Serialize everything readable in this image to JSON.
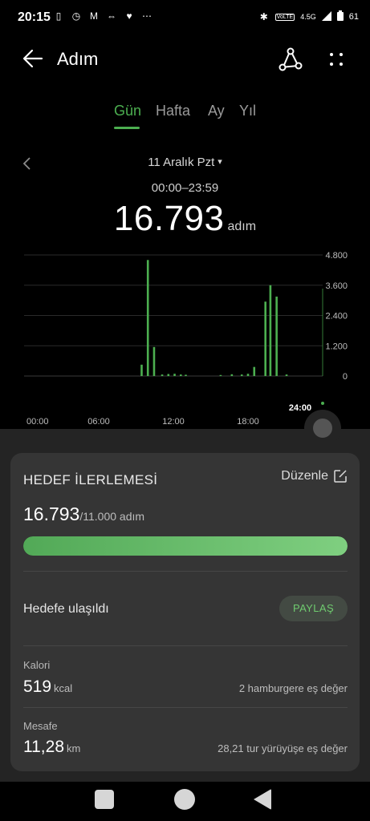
{
  "status_bar": {
    "time": "20:15",
    "network": "4.5G",
    "network_badge": "VoLTE",
    "battery": "61",
    "left_icons": [
      "vibrate-icon",
      "alarm-icon",
      "gmail-icon",
      "sync-icon",
      "app-icon",
      "more-icon"
    ],
    "right_icons": [
      "bluetooth-icon",
      "volte-icon",
      "signal-icon",
      "battery-icon"
    ]
  },
  "app_bar": {
    "title": "Adım",
    "icons": [
      "back-arrow-icon",
      "share-icon",
      "more-vertical-icon"
    ]
  },
  "tabs": {
    "items": [
      "Gün",
      "Hafta",
      "Ay",
      "Yıl"
    ],
    "active": "Gün"
  },
  "date": {
    "label": "11 Aralık Pzt",
    "dropdown_glyph": "▾"
  },
  "summary": {
    "time_range": "00:00–23:59",
    "steps": "16.793",
    "steps_unit": "adım"
  },
  "chart_data": {
    "type": "bar",
    "x_unit": "hour",
    "xlim": [
      0,
      24
    ],
    "ylim": [
      0,
      4800
    ],
    "y_ticks": [
      "4.800",
      "3.600",
      "2.400",
      "1.200",
      "0"
    ],
    "y_tick_values": [
      4800,
      3600,
      2400,
      1200,
      0
    ],
    "x_ticks": [
      "00:00",
      "06:00",
      "12:00",
      "18:00"
    ],
    "x_tick_values": [
      0,
      6,
      12,
      18
    ],
    "current_marker_label": "24:00",
    "grid": true,
    "bar_color": "#4caf50",
    "bars": [
      {
        "hour": 9.45,
        "steps": 450
      },
      {
        "hour": 9.95,
        "steps": 4600
      },
      {
        "hour": 10.45,
        "steps": 1150
      },
      {
        "hour": 11.1,
        "steps": 60
      },
      {
        "hour": 11.6,
        "steps": 80
      },
      {
        "hour": 12.1,
        "steps": 90
      },
      {
        "hour": 12.6,
        "steps": 60
      },
      {
        "hour": 13.0,
        "steps": 50
      },
      {
        "hour": 15.8,
        "steps": 40
      },
      {
        "hour": 16.7,
        "steps": 70
      },
      {
        "hour": 17.5,
        "steps": 60
      },
      {
        "hour": 18.0,
        "steps": 90
      },
      {
        "hour": 18.5,
        "steps": 360
      },
      {
        "hour": 19.4,
        "steps": 2950
      },
      {
        "hour": 19.8,
        "steps": 3600
      },
      {
        "hour": 20.3,
        "steps": 3150
      },
      {
        "hour": 21.1,
        "steps": 60
      }
    ]
  },
  "goal_card": {
    "title": "HEDEF İLERLEMESİ",
    "edit_label": "Düzenle",
    "current": "16.793",
    "target": "/11.000 adım",
    "progress_fraction": 1.0,
    "goal_status": "Hedefe ulaşıldı",
    "share_label": "PAYLAŞ",
    "calories": {
      "label": "Kalori",
      "value": "519",
      "unit": "kcal",
      "equivalent": "2 hamburgere eş değer"
    },
    "distance": {
      "label": "Mesafe",
      "value": "11,28",
      "unit": "km",
      "equivalent": "28,21 tur yürüyüşe eş değer"
    }
  },
  "colors": {
    "accent": "#4caf50",
    "background": "#000000",
    "sheet": "#242424",
    "card": "#353535"
  }
}
